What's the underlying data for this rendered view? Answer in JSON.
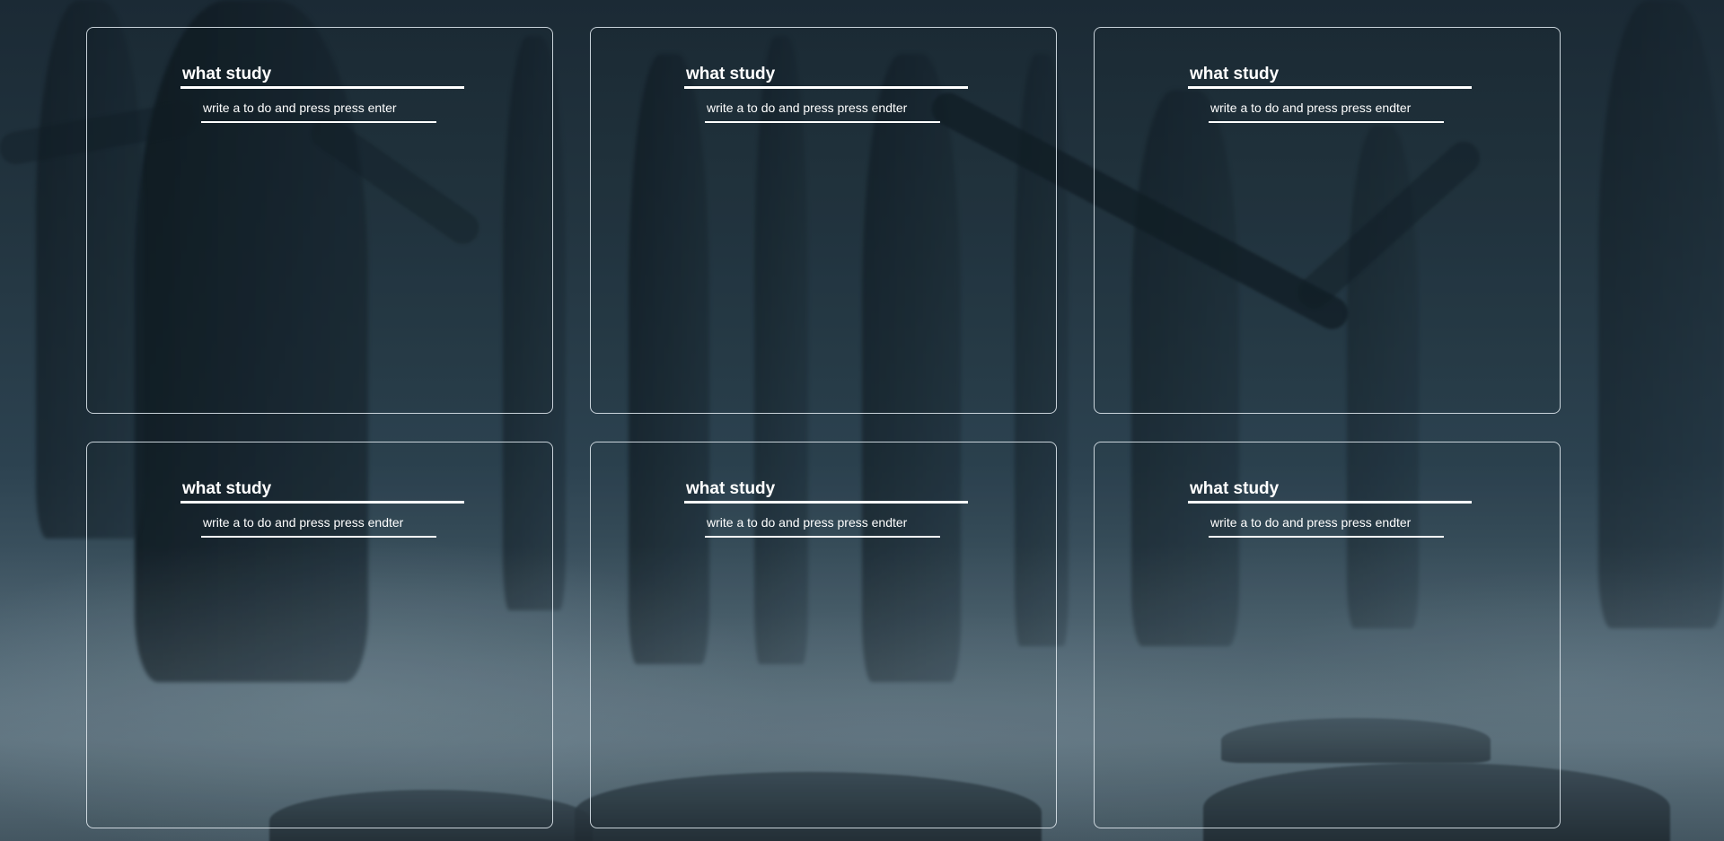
{
  "cards": [
    {
      "title": "what study",
      "input_placeholder": "write a to do and press press enter",
      "input_value": ""
    },
    {
      "title": "what study",
      "input_placeholder": "write a to do and press press endter",
      "input_value": ""
    },
    {
      "title": "what study",
      "input_placeholder": "write a to do and press press endter",
      "input_value": ""
    },
    {
      "title": "what study",
      "input_placeholder": "write a to do and press press endter",
      "input_value": ""
    },
    {
      "title": "what study",
      "input_placeholder": "write a to do and press press endter",
      "input_value": ""
    },
    {
      "title": "what study",
      "input_placeholder": "write a to do and press press endter",
      "input_value": ""
    }
  ],
  "colors": {
    "text": "#ffffff",
    "card_border": "#dce4eb",
    "background_top": "#1b2a35",
    "background_fog": "#5a6f7b"
  }
}
